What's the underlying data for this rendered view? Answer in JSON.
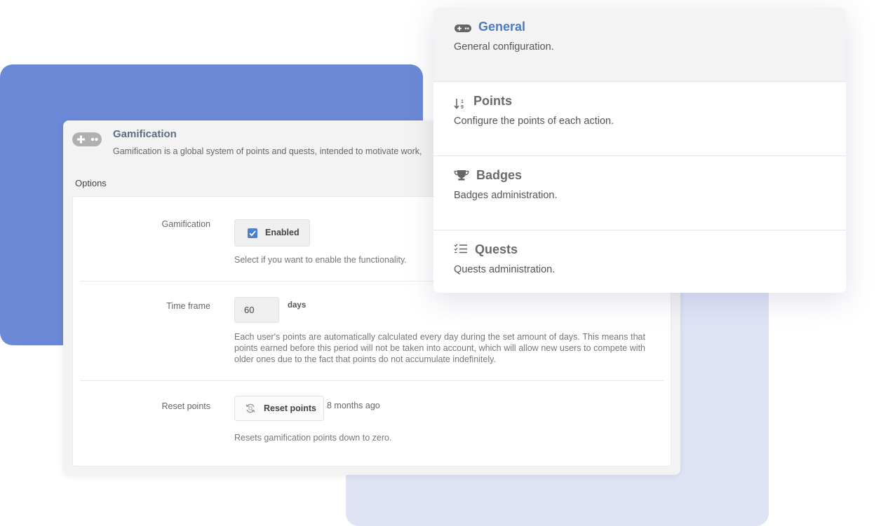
{
  "panel": {
    "title": "Gamification",
    "description": "Gamification is a global system of points and quests, intended to motivate work,",
    "options_label": "Options"
  },
  "options": {
    "gamification": {
      "label": "Gamification",
      "checkbox_label": "Enabled",
      "checked": true,
      "help": "Select if you want to enable the functionality."
    },
    "time_frame": {
      "label": "Time frame",
      "value": "60",
      "unit": "days",
      "help": "Each user's points are automatically calculated every day during the set amount of days. This means that points earned before this period will not be taken into account, which will allow new users to compete with older ones due to the fact that points do not accumulate indefinitely."
    },
    "reset_points": {
      "label": "Reset points",
      "button_label": "Reset points",
      "last_reset": "8 months ago",
      "help": "Resets gamification points down to zero."
    }
  },
  "menu": {
    "items": [
      {
        "title": "General",
        "description": "General configuration.",
        "icon": "gamepad-icon",
        "active": true
      },
      {
        "title": "Points",
        "description": "Configure the points of each action.",
        "icon": "sort-numeric-icon",
        "active": false
      },
      {
        "title": "Badges",
        "description": "Badges administration.",
        "icon": "trophy-icon",
        "active": false
      },
      {
        "title": "Quests",
        "description": "Quests administration.",
        "icon": "checklist-icon",
        "active": false
      }
    ]
  },
  "colors": {
    "accent": "#4d7bc3",
    "blue_backdrop": "#6b89d6",
    "lavender_backdrop": "#dfe3f6",
    "checkbox": "#4b80d0"
  }
}
